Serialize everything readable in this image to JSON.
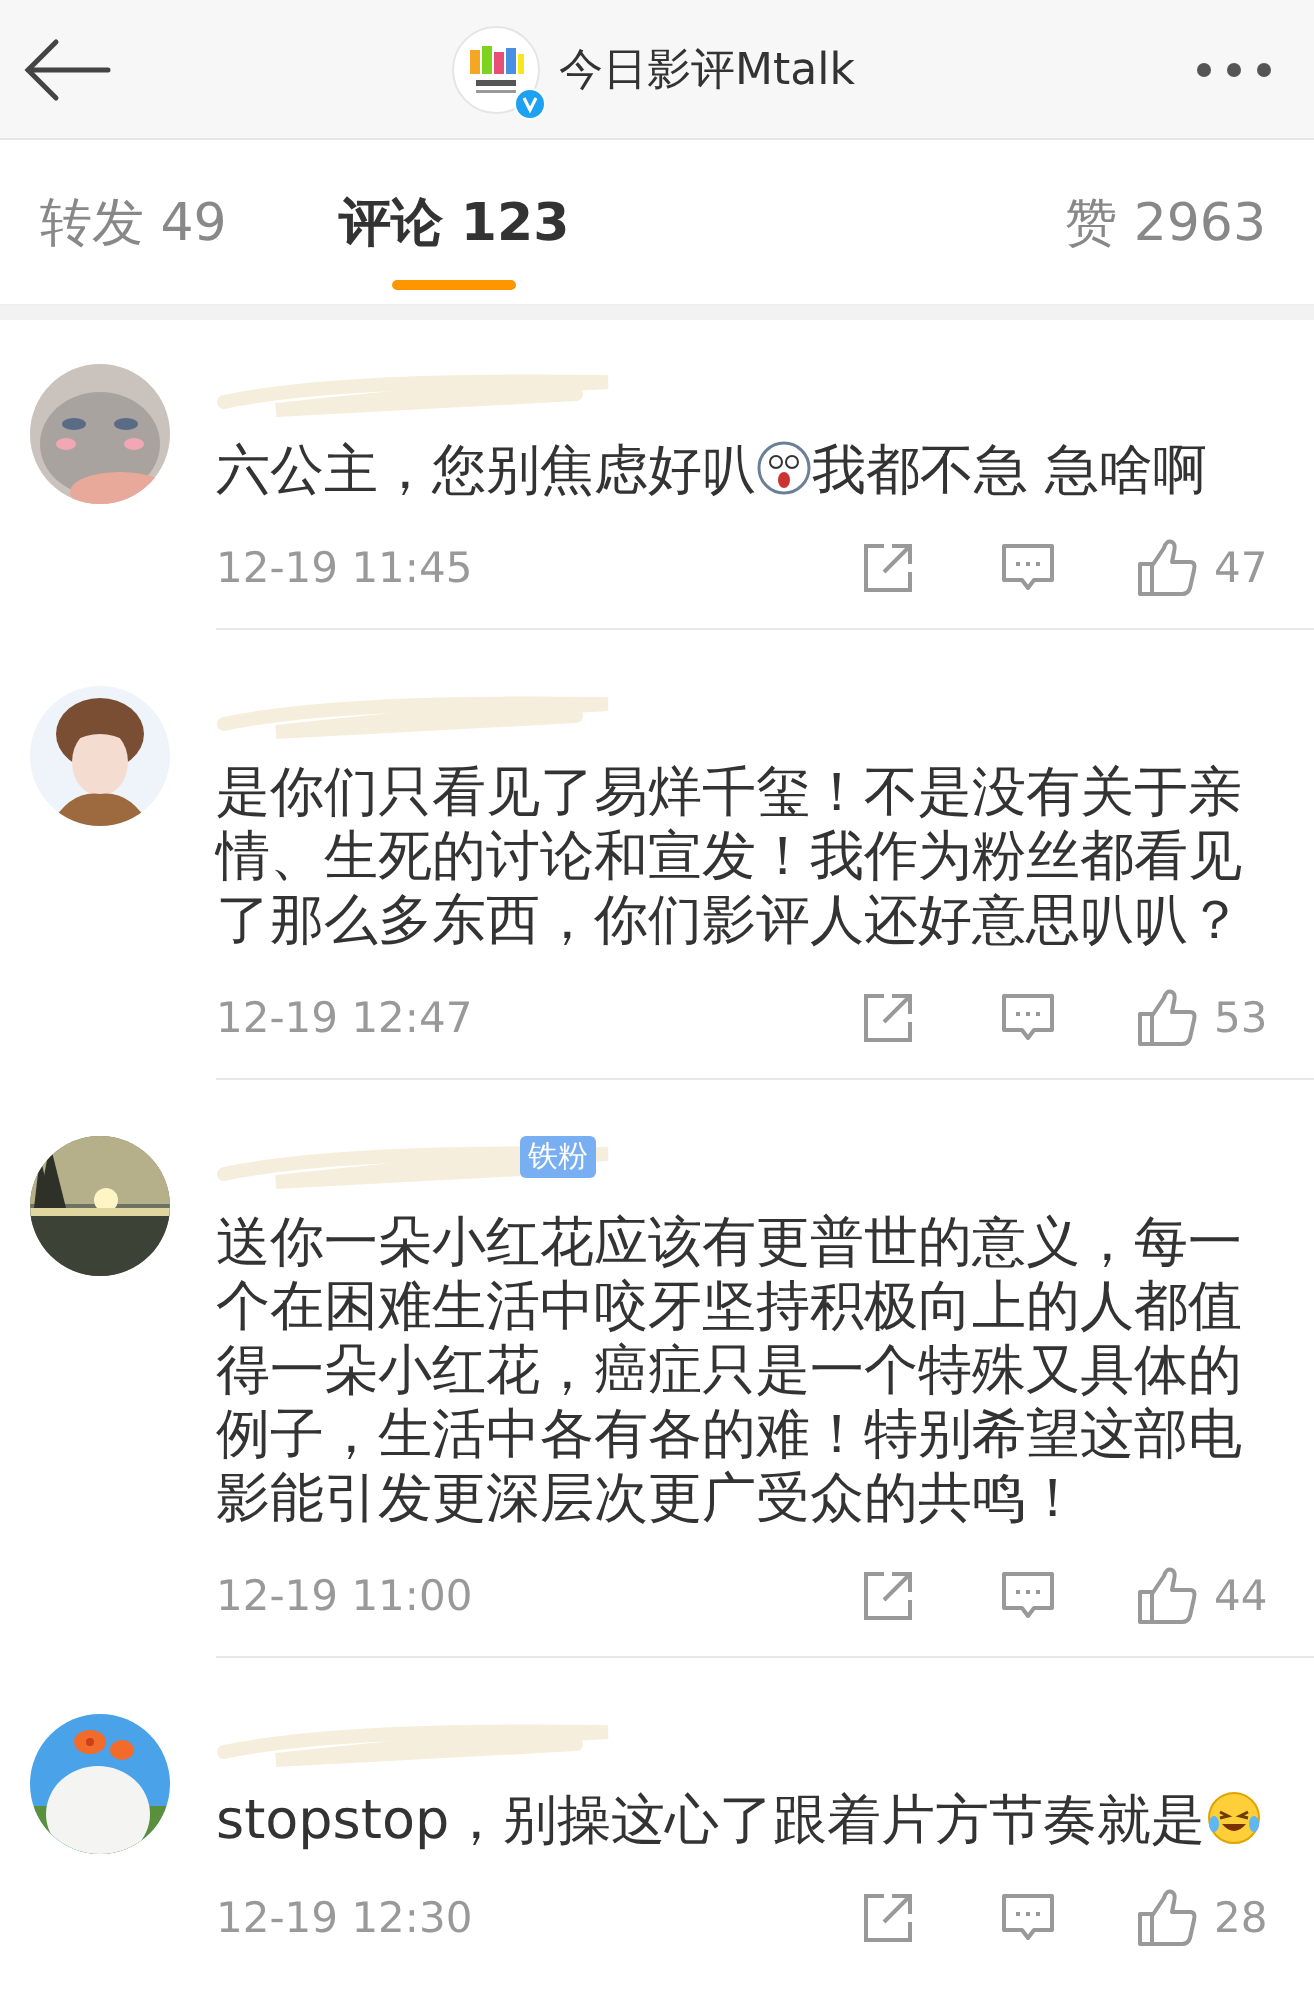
{
  "header": {
    "title": "今日影评Mtalk",
    "verified": true
  },
  "tabs": [
    {
      "label": "转发 49",
      "selected": false
    },
    {
      "label": "评论 123",
      "selected": true
    },
    {
      "label": "赞 2963",
      "selected": false
    }
  ],
  "comments": [
    {
      "avatar": {
        "kind": "picture"
      },
      "body": [
        {
          "kind": "text",
          "text": "六公主，您别焦虑好叭"
        },
        {
          "kind": "shock"
        },
        {
          "kind": "text",
          "text": "我都不急 急啥啊"
        }
      ],
      "time": "12-19 11:45",
      "likes": "47"
    },
    {
      "avatar": {
        "kind": "picture"
      },
      "body": [
        {
          "kind": "text",
          "text": "是你们只看见了易烊千玺！不是没有关于亲情、生死的讨论和宣发！我作为粉丝都看见了那么多东西，你们影评人还好意思叭叭？"
        }
      ],
      "time": "12-19 12:47",
      "likes": "53"
    },
    {
      "avatar": {
        "kind": "picture"
      },
      "badge": "铁粉",
      "body": [
        {
          "kind": "text",
          "text": "送你一朵小红花应该有更普世的意义，每一个在困难生活中咬牙坚持积极向上的人都值得一朵小红花，癌症只是一个特殊又具体的例子，生活中各有各的难！特别希望这部电影能引发更深层次更广受众的共鸣！"
        }
      ],
      "time": "12-19 11:00",
      "likes": "44"
    },
    {
      "avatar": {
        "kind": "picture"
      },
      "body": [
        {
          "kind": "text",
          "text": "stopstop，别操这心了跟着片方节奏就是"
        },
        {
          "kind": "laugh"
        }
      ],
      "time": "12-19 12:30",
      "likes": "28"
    }
  ]
}
